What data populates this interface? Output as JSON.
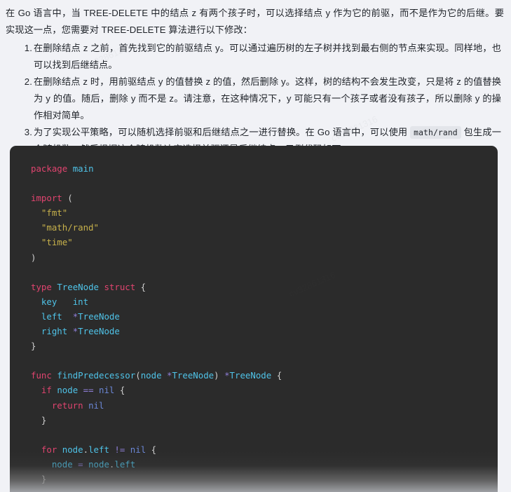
{
  "page": {
    "background_color": "#f1f2f6",
    "text_color": "#1f2329"
  },
  "prose": {
    "intro": "在 Go 语言中，当 TREE-DELETE 中的结点 z 有两个孩子时，可以选择结点 y 作为它的前驱，而不是作为它的后继。要实现这一点，您需要对 TREE-DELETE 算法进行以下修改：",
    "steps": [
      {
        "index": "1.",
        "text": "在删除结点 z 之前，首先找到它的前驱结点 y。可以通过遍历树的左子树并找到最右侧的节点来实现。同样地，也可以找到后继结点。"
      },
      {
        "index": "2.",
        "text": "在删除结点 z 时，用前驱结点 y 的值替换 z 的值，然后删除 y。这样，树的结构不会发生改变，只是将 z 的值替换为 y 的值。随后，删除 y 而不是 z。请注意，在这种情况下，y 可能只有一个孩子或者没有孩子，所以删除 y 的操作相对简单。"
      },
      {
        "index": "3.",
        "text_before_code": "为了实现公平策略，可以随机选择前驱和后继结点之一进行替换。在 Go 语言中，可以使用 ",
        "inline_code": "math/rand",
        "text_after_code": " 包生成一个随机数，然后根据这个随机数决定选择前驱还是后继结点。示例代码如下："
      }
    ]
  },
  "code_block": {
    "language": "go",
    "background_color": "#2b2b2b",
    "colors": {
      "keyword": "#e0446f",
      "type": "#4fc3e8",
      "string": "#c7b14b",
      "operator": "#8f7fd8",
      "constant": "#6b87d6",
      "punctuation": "#cfcfcf"
    },
    "lines": [
      [
        {
          "t": "package ",
          "c": "k"
        },
        {
          "t": "main",
          "c": "t"
        }
      ],
      [],
      [
        {
          "t": "import ",
          "c": "k"
        },
        {
          "t": "(",
          "c": "p"
        }
      ],
      [
        {
          "t": "  ",
          "c": "p"
        },
        {
          "t": "\"fmt\"",
          "c": "s"
        }
      ],
      [
        {
          "t": "  ",
          "c": "p"
        },
        {
          "t": "\"math/rand\"",
          "c": "s"
        }
      ],
      [
        {
          "t": "  ",
          "c": "p"
        },
        {
          "t": "\"time\"",
          "c": "s"
        }
      ],
      [
        {
          "t": ")",
          "c": "p"
        }
      ],
      [],
      [
        {
          "t": "type ",
          "c": "k"
        },
        {
          "t": "TreeNode ",
          "c": "t"
        },
        {
          "t": "struct ",
          "c": "k"
        },
        {
          "t": "{",
          "c": "p"
        }
      ],
      [
        {
          "t": "  ",
          "c": "p"
        },
        {
          "t": "key",
          "c": "t"
        },
        {
          "t": "   ",
          "c": "p"
        },
        {
          "t": "int",
          "c": "t"
        }
      ],
      [
        {
          "t": "  ",
          "c": "p"
        },
        {
          "t": "left",
          "c": "t"
        },
        {
          "t": "  ",
          "c": "p"
        },
        {
          "t": "*",
          "c": "op"
        },
        {
          "t": "TreeNode",
          "c": "t"
        }
      ],
      [
        {
          "t": "  ",
          "c": "p"
        },
        {
          "t": "right",
          "c": "t"
        },
        {
          "t": " ",
          "c": "p"
        },
        {
          "t": "*",
          "c": "op"
        },
        {
          "t": "TreeNode",
          "c": "t"
        }
      ],
      [
        {
          "t": "}",
          "c": "p"
        }
      ],
      [],
      [
        {
          "t": "func ",
          "c": "k"
        },
        {
          "t": "findPredecessor",
          "c": "t"
        },
        {
          "t": "(",
          "c": "p"
        },
        {
          "t": "node ",
          "c": "t"
        },
        {
          "t": "*",
          "c": "op"
        },
        {
          "t": "TreeNode",
          "c": "t"
        },
        {
          "t": ") ",
          "c": "p"
        },
        {
          "t": "*",
          "c": "op"
        },
        {
          "t": "TreeNode",
          "c": "t"
        },
        {
          "t": " {",
          "c": "p"
        }
      ],
      [
        {
          "t": "  ",
          "c": "p"
        },
        {
          "t": "if ",
          "c": "k"
        },
        {
          "t": "node ",
          "c": "t"
        },
        {
          "t": "== ",
          "c": "op"
        },
        {
          "t": "nil",
          "c": "n"
        },
        {
          "t": " {",
          "c": "p"
        }
      ],
      [
        {
          "t": "    ",
          "c": "p"
        },
        {
          "t": "return ",
          "c": "k"
        },
        {
          "t": "nil",
          "c": "n"
        }
      ],
      [
        {
          "t": "  }",
          "c": "p"
        }
      ],
      [],
      [
        {
          "t": "  ",
          "c": "p"
        },
        {
          "t": "for ",
          "c": "k"
        },
        {
          "t": "node",
          "c": "t"
        },
        {
          "t": ".",
          "c": "p"
        },
        {
          "t": "left ",
          "c": "t"
        },
        {
          "t": "!= ",
          "c": "op"
        },
        {
          "t": "nil",
          "c": "n"
        },
        {
          "t": " {",
          "c": "p"
        }
      ],
      [
        {
          "t": "    ",
          "c": "p"
        },
        {
          "t": "node ",
          "c": "t"
        },
        {
          "t": "= ",
          "c": "op"
        },
        {
          "t": "node",
          "c": "t"
        },
        {
          "t": ".",
          "c": "p"
        },
        {
          "t": "left",
          "c": "t"
        }
      ],
      [
        {
          "t": "  }",
          "c": "p"
        }
      ]
    ]
  },
  "watermark": {
    "text": "cv32861316"
  }
}
